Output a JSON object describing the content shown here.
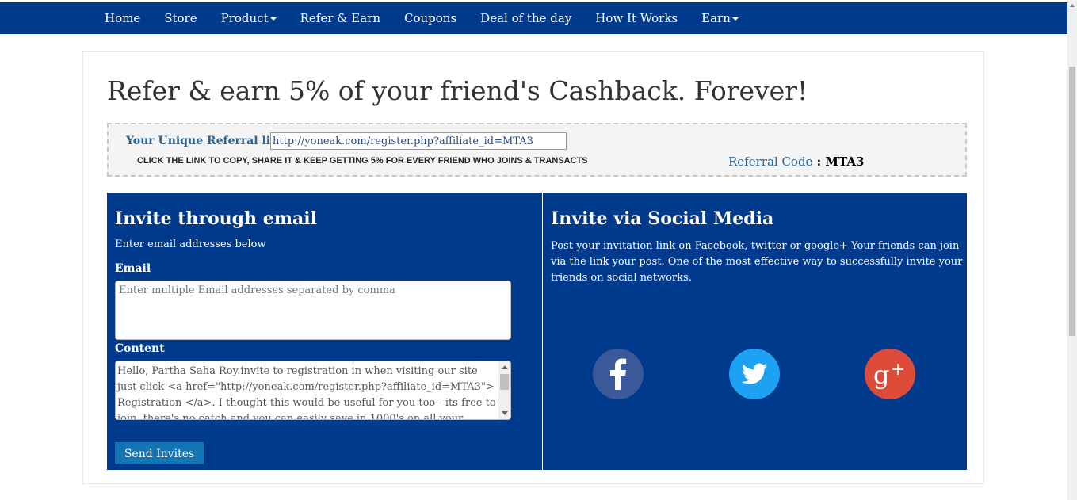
{
  "nav": {
    "items": [
      {
        "label": "Home",
        "has_dropdown": false
      },
      {
        "label": "Store",
        "has_dropdown": false
      },
      {
        "label": "Product",
        "has_dropdown": true
      },
      {
        "label": "Refer & Earn",
        "has_dropdown": false
      },
      {
        "label": "Coupons",
        "has_dropdown": false
      },
      {
        "label": "Deal of the day",
        "has_dropdown": false
      },
      {
        "label": "How It Works",
        "has_dropdown": false
      },
      {
        "label": "Earn",
        "has_dropdown": true
      }
    ]
  },
  "page": {
    "title": "Refer & earn 5% of your friend's Cashback. Forever!"
  },
  "referral": {
    "link_label": "Your Unique Referral link",
    "link_value": "http://yoneak.com/register.php?affiliate_id=MTA3",
    "note": "CLICK THE LINK TO COPY, SHARE IT & KEEP GETTING 5% FOR EVERY FRIEND WHO JOINS & TRANSACTS",
    "code_label": "Referral Code",
    "code_separator": " : ",
    "code_value": "MTA3"
  },
  "email_panel": {
    "title": "Invite through email",
    "subtitle": "Enter email addresses below",
    "email_label": "Email",
    "email_placeholder": "Enter multiple Email addresses separated by comma",
    "content_label": "Content",
    "content_text": "Hello, Partha Saha Roy.invite to registration in when visiting our site just click <a href=\"http://yoneak.com/register.php?affiliate_id=MTA3\"> Registration </a>. I thought this would be useful for you too - its free to join, there's no catch and you can easily save in 1000's on all your shopping as some stores have Cashback as high",
    "send_label": "Send Invites"
  },
  "social_panel": {
    "title": "Invite via Social Media",
    "description": "Post your invitation link on Facebook, twitter or google+ Your friends can join via the link your post. One of the most effective way to successfully invite your friends on social networks.",
    "icons": [
      "facebook-icon",
      "twitter-icon",
      "google-plus-icon"
    ]
  },
  "colors": {
    "nav_bg": "#003a8c",
    "panel_bg": "#003a8c",
    "button_bg": "#1475b5",
    "facebook": "#3b5998",
    "twitter": "#1da1f2",
    "google_plus": "#dd4b39",
    "link_text": "#2a6496"
  }
}
